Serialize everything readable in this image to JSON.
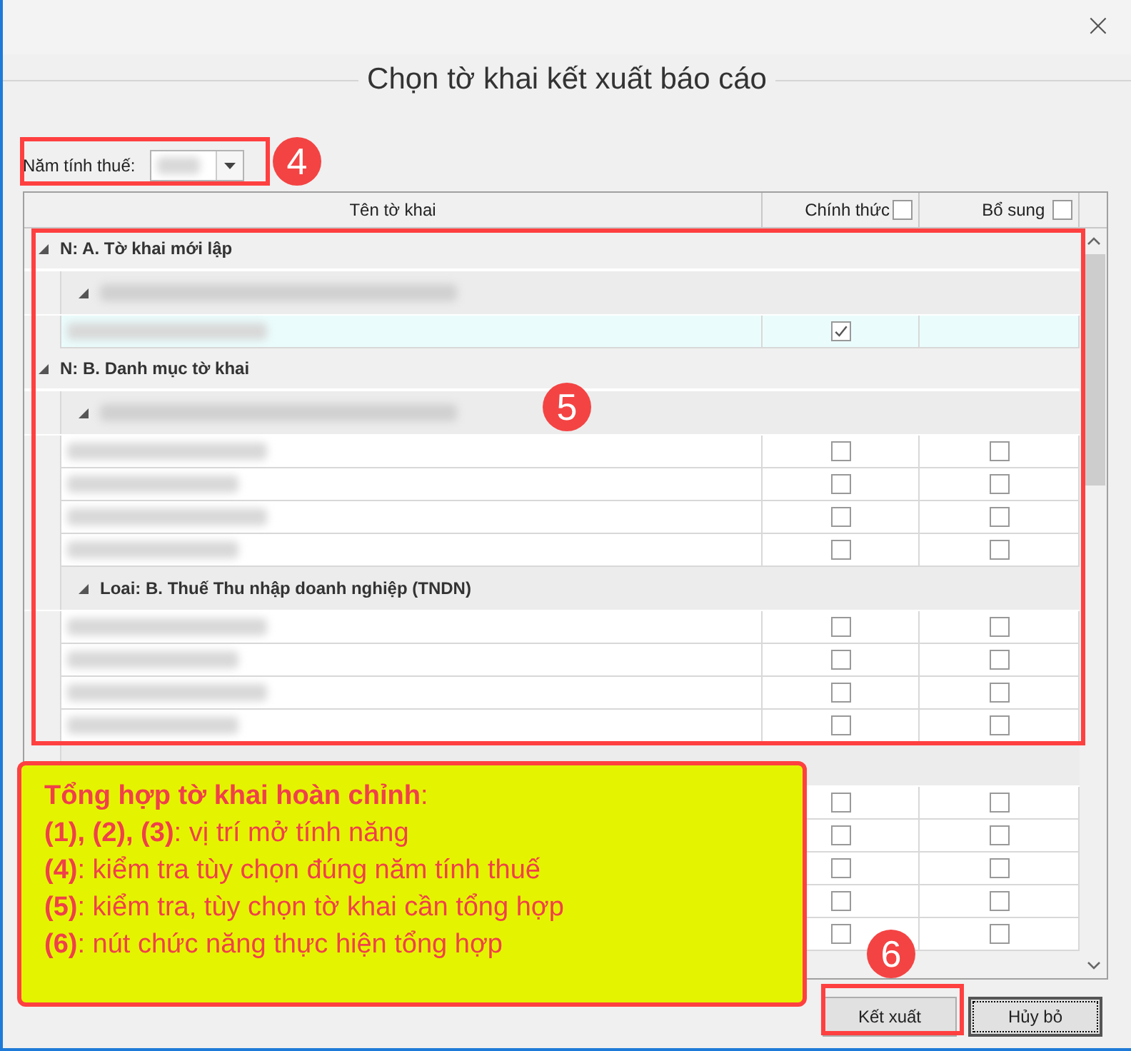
{
  "window": {
    "close": "×",
    "title": "Chọn tờ khai kết xuất báo cáo"
  },
  "filter": {
    "label": "Năm tính thuế:",
    "value_blurred": true
  },
  "table": {
    "columns": [
      {
        "label": "Tên tờ khai"
      },
      {
        "label": "Chính thức",
        "checked": false
      },
      {
        "label": "Bổ sung",
        "checked": false
      }
    ],
    "groups": [
      {
        "label": "N: A. Tờ khai mới lập",
        "expanded": true,
        "children": [
          {
            "blurred": true,
            "expanded": true,
            "children": [
              {
                "blurred": true,
                "selected": true,
                "official": {
                  "checked": true
                }
              }
            ]
          }
        ]
      },
      {
        "label": "N: B. Danh mục tờ khai",
        "expanded": true,
        "children": [
          {
            "blurred": true,
            "expanded": true,
            "children": [
              {
                "blurred": true,
                "selected": false,
                "official": {
                  "checked": false
                },
                "supplement": {
                  "checked": false
                }
              },
              {
                "blurred": true,
                "selected": false,
                "official": {
                  "checked": false
                },
                "supplement": {
                  "checked": false
                }
              },
              {
                "blurred": true,
                "selected": false,
                "official": {
                  "checked": false
                },
                "supplement": {
                  "checked": false
                }
              },
              {
                "blurred": true,
                "selected": false,
                "official": {
                  "checked": false
                },
                "supplement": {
                  "checked": false
                }
              }
            ]
          },
          {
            "label": "Loai: B. Thuế Thu nhập doanh nghiệp (TNDN)",
            "blurred": false,
            "expanded": true,
            "children": [
              {
                "blurred": true,
                "selected": false,
                "official": {
                  "checked": false
                },
                "supplement": {
                  "checked": false
                }
              },
              {
                "blurred": true,
                "selected": false,
                "official": {
                  "checked": false
                },
                "supplement": {
                  "checked": false
                }
              },
              {
                "blurred": true,
                "selected": false,
                "official": {
                  "checked": false
                },
                "supplement": {
                  "checked": false
                }
              },
              {
                "blurred": true,
                "selected": false,
                "official": {
                  "checked": false
                },
                "supplement": {
                  "checked": false
                }
              }
            ]
          },
          {
            "blurred": false,
            "children": [
              {
                "blurred": false,
                "selected": false,
                "official": {
                  "checked": false
                },
                "supplement": {
                  "checked": false
                }
              },
              {
                "blurred": false,
                "selected": false,
                "official": {
                  "checked": false
                },
                "supplement": {
                  "checked": false
                }
              },
              {
                "blurred": false,
                "selected": false,
                "official": {
                  "checked": false
                },
                "supplement": {
                  "checked": false
                }
              },
              {
                "blurred": false,
                "selected": false,
                "official": {
                  "checked": false
                },
                "supplement": {
                  "checked": false
                }
              },
              {
                "blurred": false,
                "selected": false,
                "official": {
                  "checked": false
                },
                "supplement": {
                  "checked": false
                }
              }
            ]
          }
        ]
      }
    ]
  },
  "buttons": [
    {
      "label": "Kết xuất"
    },
    {
      "label": "Hủy bỏ",
      "focused": true
    }
  ],
  "annotations": {
    "badges": [
      "4",
      "5",
      "6"
    ],
    "note": [
      "**Tổng hợp tờ khai hoàn chỉnh**:",
      "**(1), (2), (3)**: vị trí mở tính năng",
      "**(4)**: kiểm tra tùy chọn đúng năm tính thuế",
      "**(5)**: kiểm tra, tùy chọn tờ khai cần tổng hợp",
      "**(6)**: nút chức năng thực hiện tổng hợp"
    ]
  }
}
